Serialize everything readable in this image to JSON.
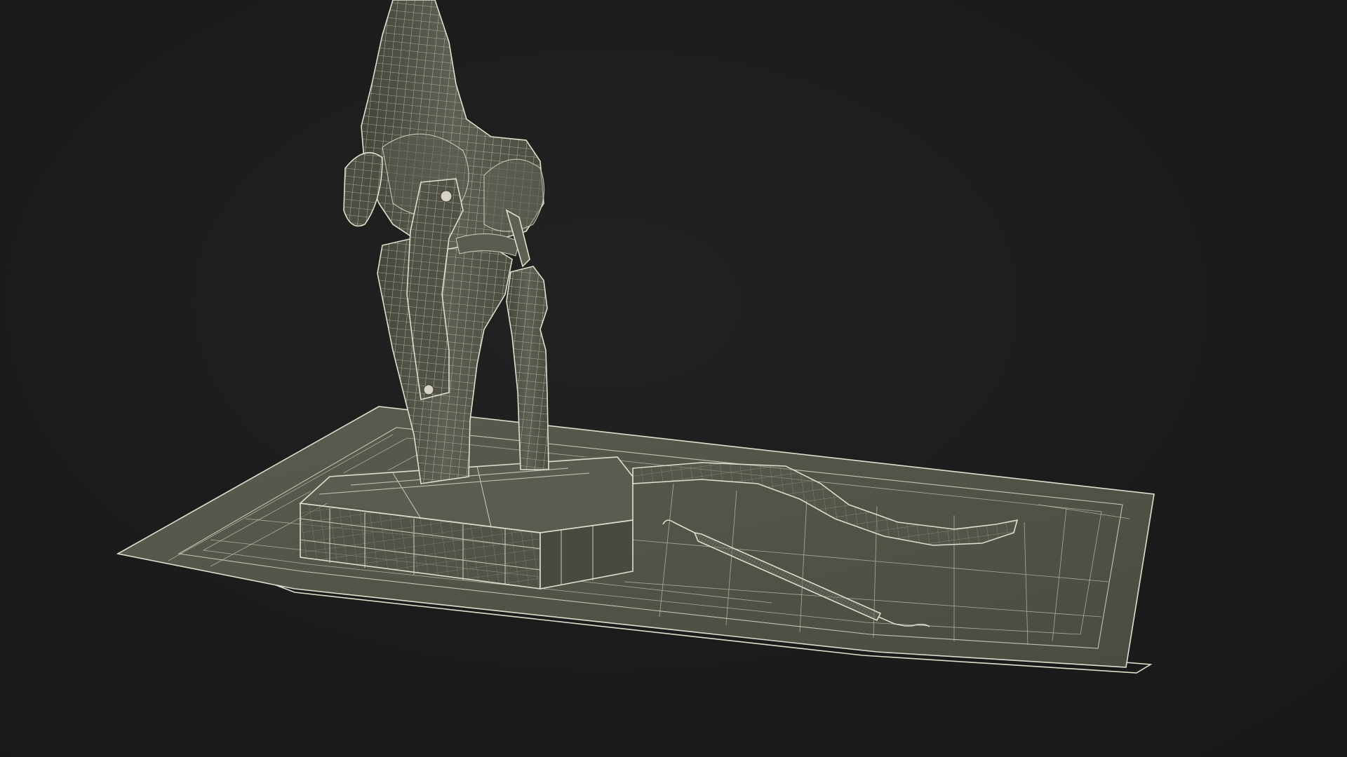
{
  "scene": {
    "colors": {
      "background": "#1c1c1c",
      "mesh_fill": "#55574a",
      "mesh_fill_dark": "#45473c",
      "mesh_fill_light": "#66685a",
      "wire": "#d9d6c6"
    }
  }
}
